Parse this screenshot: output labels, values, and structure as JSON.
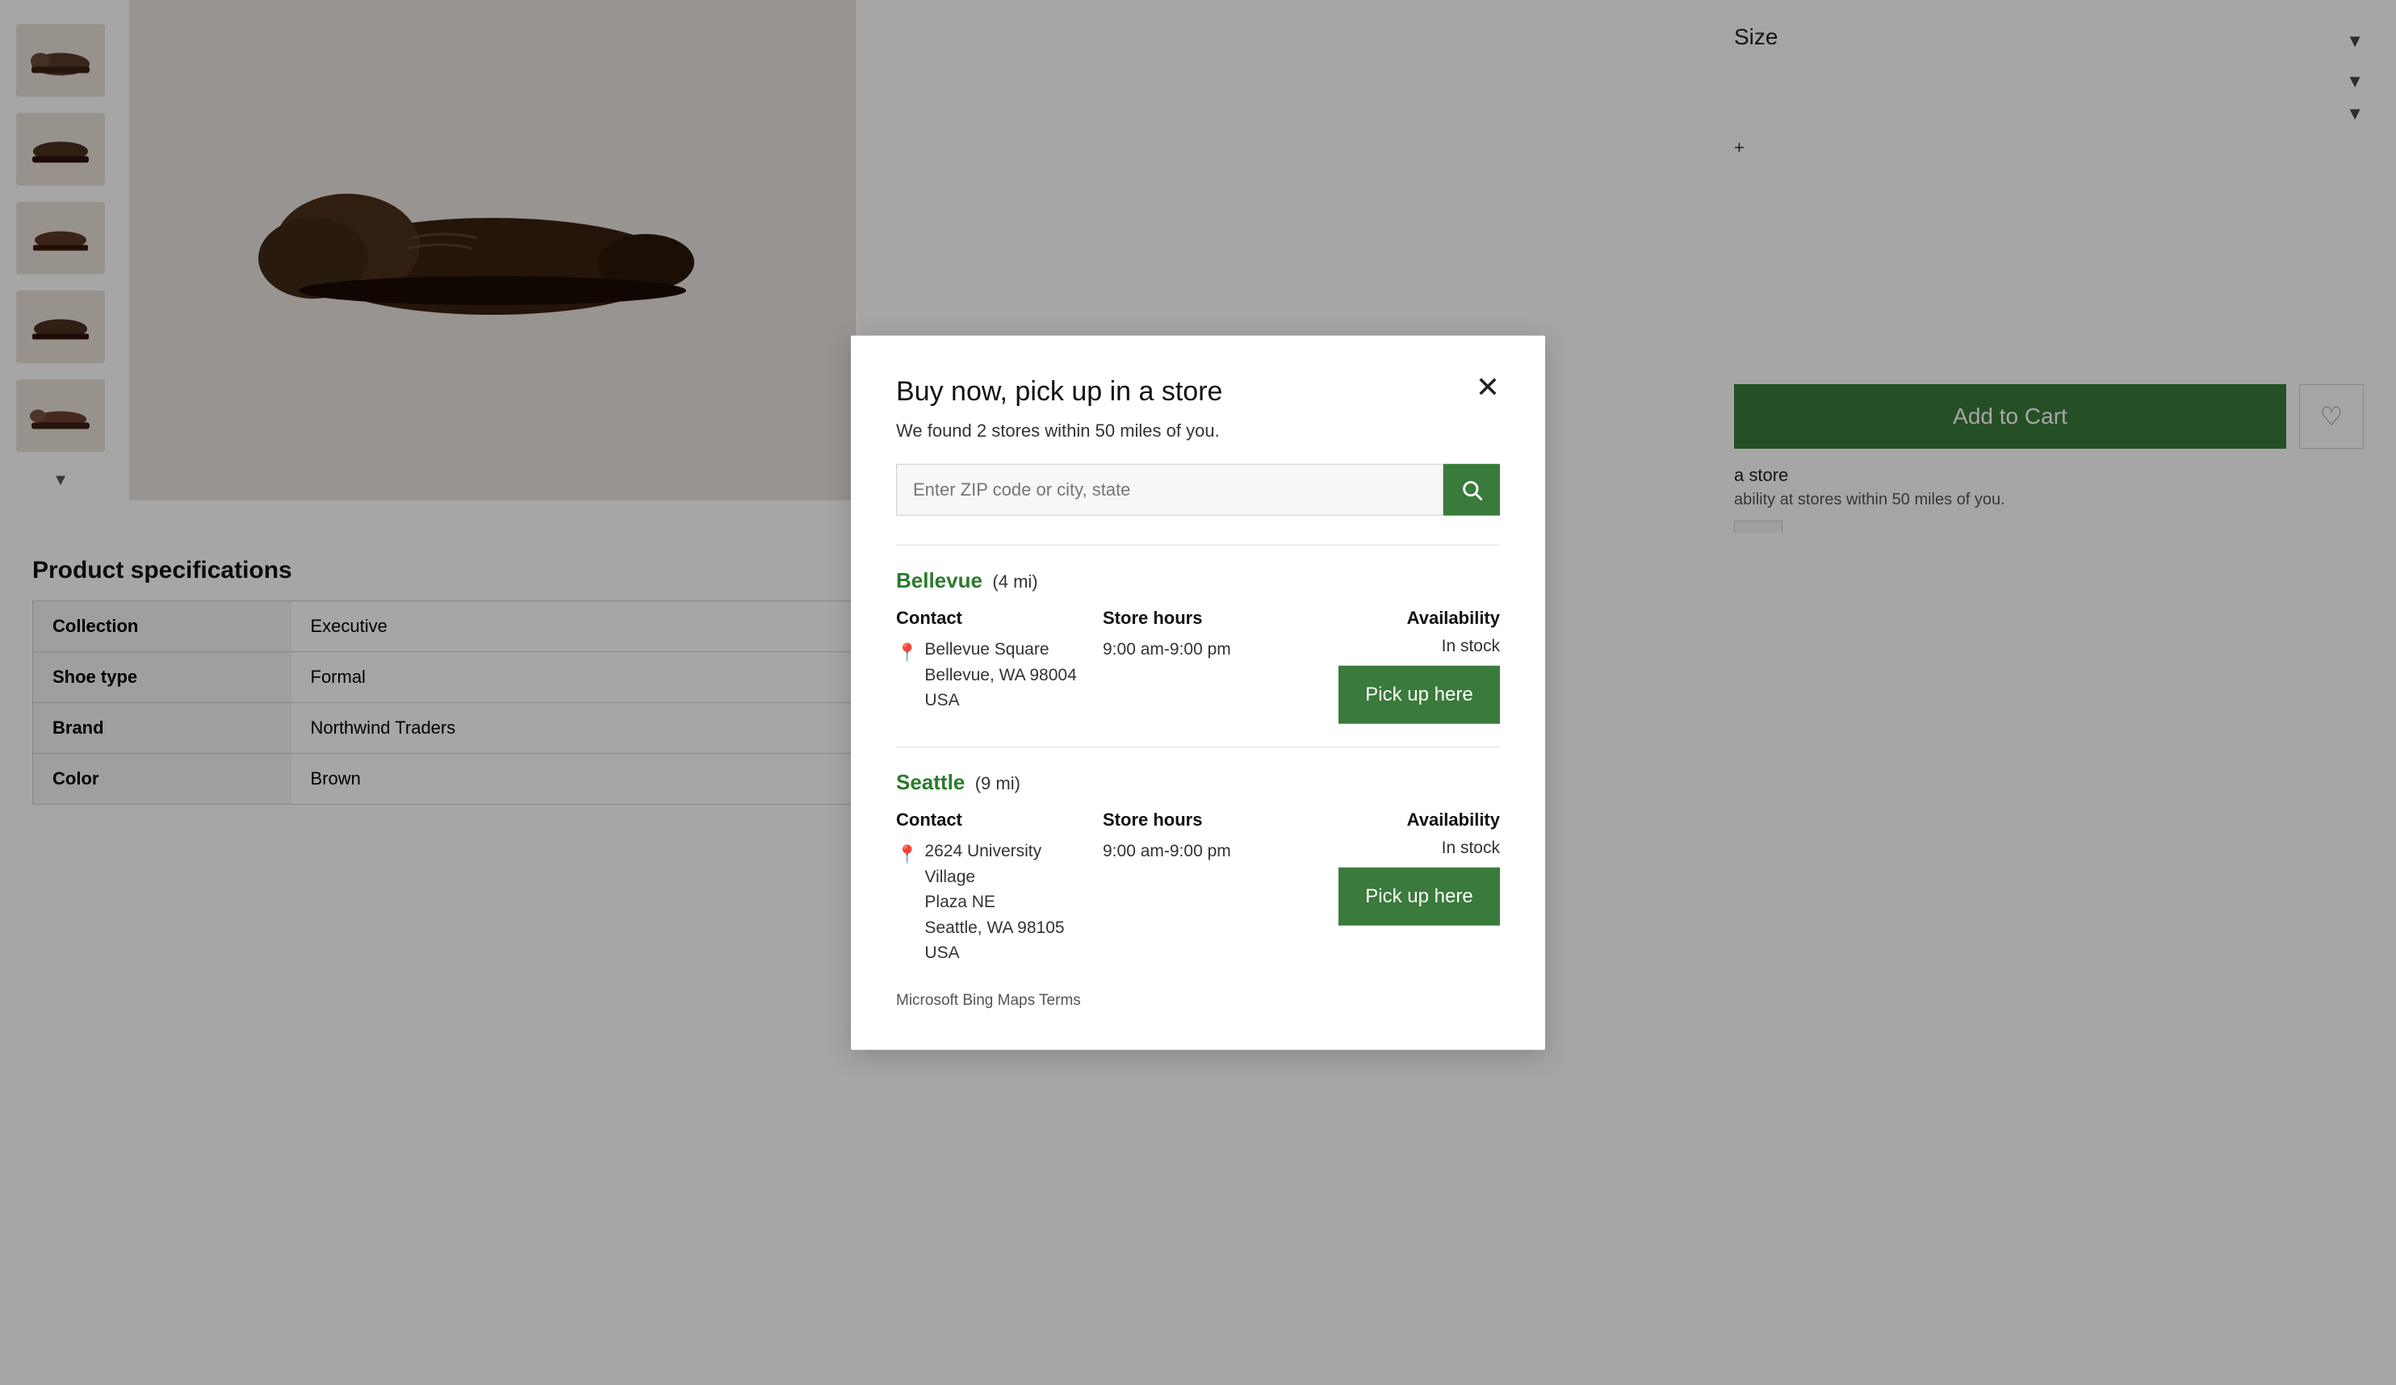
{
  "sidebar": {
    "thumbnails": [
      {
        "label": "shoe-thumb-1"
      },
      {
        "label": "shoe-thumb-2"
      },
      {
        "label": "shoe-thumb-3"
      },
      {
        "label": "shoe-thumb-4"
      },
      {
        "label": "shoe-thumb-5"
      }
    ],
    "scroll_down_label": "▼"
  },
  "right_panel": {
    "size_label": "Size",
    "dropdown_arrows": [
      "▼",
      "▼",
      "▼"
    ],
    "add_to_cart_label": "Add to Cart",
    "wishlist_icon": "♡",
    "pickup_in_store_text": "a store",
    "store_availability_text": "ability at stores within 50 miles of you."
  },
  "product_specs": {
    "title": "Product specifications",
    "rows": [
      {
        "key": "Collection",
        "value": "Executive"
      },
      {
        "key": "Shoe type",
        "value": "Formal"
      },
      {
        "key": "Brand",
        "value": "Northwind Traders"
      },
      {
        "key": "Color",
        "value": "Brown"
      }
    ]
  },
  "modal": {
    "title": "Buy now, pick up in a store",
    "close_icon": "✕",
    "subtitle": "We found 2 stores within 50 miles of you.",
    "search_placeholder": "Enter ZIP code or city, state",
    "search_icon": "🔍",
    "stores": [
      {
        "name": "Bellevue",
        "distance": "(4 mi)",
        "contact_header": "Contact",
        "hours_header": "Store hours",
        "availability_header": "Availability",
        "address_line1": "Bellevue Square",
        "address_line2": "Bellevue, WA 98004",
        "address_line3": "USA",
        "hours": "9:00 am-9:00 pm",
        "availability": "In stock",
        "pickup_btn": "Pick up here"
      },
      {
        "name": "Seattle",
        "distance": "(9 mi)",
        "contact_header": "Contact",
        "hours_header": "Store hours",
        "availability_header": "Availability",
        "address_line1": "2624 University Village",
        "address_line2": "Plaza NE",
        "address_line3": "Seattle, WA 98105",
        "address_line4": "USA",
        "hours": "9:00 am-9:00 pm",
        "availability": "In stock",
        "pickup_btn": "Pick up here"
      }
    ],
    "bing_maps_terms": "Microsoft Bing Maps Terms"
  }
}
